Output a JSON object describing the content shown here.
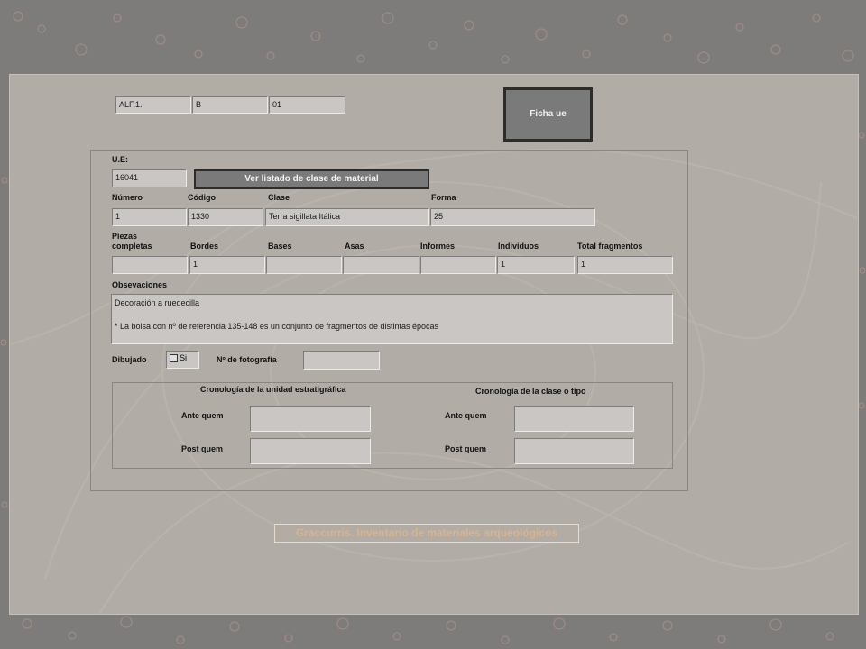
{
  "header": {
    "code1": "ALF.1.",
    "code2": "B",
    "code3": "01",
    "ficha_button": "Ficha ue"
  },
  "ue": {
    "label": "U.E:",
    "value": "16041",
    "listado_button": "Ver listado de clase de material"
  },
  "row1": {
    "numero_label": "Número",
    "numero_value": "1",
    "codigo_label": "Código",
    "codigo_value": "1330",
    "clase_label": "Clase",
    "clase_value": "Terra sigillata Itálica",
    "forma_label": "Forma",
    "forma_value": "25"
  },
  "row2": {
    "piezas_label_1": "Piezas",
    "piezas_label_2": "completas",
    "piezas_value": "",
    "bordes_label": "Bordes",
    "bordes_value": "1",
    "bases_label": "Bases",
    "bases_value": "",
    "asas_label": "Asas",
    "asas_value": "",
    "informes_label": "Informes",
    "informes_value": "",
    "individuos_label": "Individuos",
    "individuos_value": "1",
    "total_label": "Total fragmentos",
    "total_value": "1"
  },
  "observaciones": {
    "label": "Obsevaciones",
    "line1": "Decoración a ruedecilla",
    "line2": "* La bolsa con nº de referencia 135-148 es un conjunto de fragmentos de distintas épocas"
  },
  "dibujado": {
    "label": "Dibujado",
    "checkbox_label": "Si",
    "foto_label": "Nº de fotografía",
    "foto_value": ""
  },
  "cronologia": {
    "unidad_title": "Cronología de la unidad estratigráfica",
    "clase_title": "Cronología de la clase o tipo",
    "ante_quem_label": "Ante quem",
    "post_quem_label": "Post quem",
    "unidad_ante": "",
    "unidad_post": "",
    "clase_ante": "",
    "clase_post": ""
  },
  "footer": {
    "title": "Graccurris. Inventario de materiales arqueológicos"
  },
  "colors": {
    "background": "#7e7c7b",
    "panel": "#b2aca6",
    "field": "#c9c6c3",
    "button": "#7a7a7a",
    "footer_text": "#d8b48f"
  }
}
